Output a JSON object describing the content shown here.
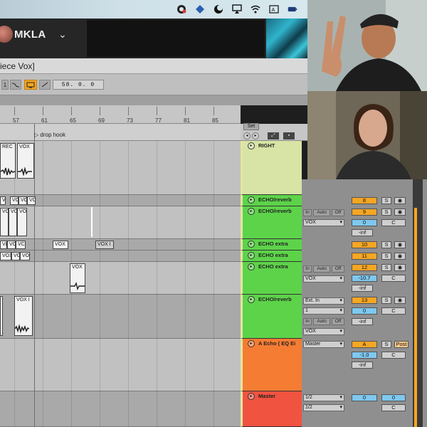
{
  "menubar": {
    "icons": [
      "creative-cloud-icon",
      "app-icon",
      "moon-icon",
      "airplay-icon",
      "wifi-icon",
      "keyboard-icon",
      "battery-icon"
    ]
  },
  "account": {
    "username": "MKLA"
  },
  "ableton": {
    "title": "iece Vox]",
    "transport": {
      "first_button": "1",
      "position": "58.  0.  0"
    },
    "ruler_ticks": [
      "57",
      "61",
      "65",
      "69",
      "73",
      "77",
      "81",
      "85"
    ],
    "locator_label": "drop hook",
    "set_label": "Set"
  },
  "clips": {
    "lane1": [
      "REC",
      "VOX"
    ],
    "lane2": [
      "V",
      "VC",
      "VC",
      "VC"
    ],
    "lane3": [
      "VO",
      "VO",
      "VO"
    ],
    "lane4": [
      "V(",
      "VC",
      "VC"
    ],
    "lane4_extra": [
      "VOX",
      "VOX I"
    ],
    "lane5": [
      "VOX",
      "VO",
      "VO V"
    ],
    "lane6": [
      "VOX"
    ],
    "lane7": [
      "VOX I"
    ]
  },
  "tracks": [
    {
      "name": "RIGHT",
      "color": "#d7e4a5"
    },
    {
      "name": "ECHO/reverb",
      "color": "#5dd34a"
    },
    {
      "name": "ECHO/reverb",
      "color": "#5dd34a"
    },
    {
      "name": "ECHO extra",
      "color": "#5dd34a"
    },
    {
      "name": "ECHO extra",
      "color": "#5dd34a"
    },
    {
      "name": "ECHO extra",
      "color": "#5dd34a"
    },
    {
      "name": "ECHO/reverb",
      "color": "#5dd34a"
    },
    {
      "name": "A Echo ( EQ Ei",
      "color": "#f57c33"
    },
    {
      "name": "Master",
      "color": "#f05340"
    }
  ],
  "mixer": {
    "row_echo1": {
      "num": "8",
      "s": "S"
    },
    "row_echo2": {
      "chips": [
        "In",
        "Auto",
        "Off"
      ],
      "input": "VOX",
      "num": "9",
      "s": "S",
      "vol": "0",
      "pan": "C",
      "send": "-inf"
    },
    "row_extra1": {
      "num": "10",
      "s": "S"
    },
    "row_extra2": {
      "num": "11",
      "s": "S"
    },
    "row_extra3": {
      "chips": [
        "In",
        "Auto",
        "Off"
      ],
      "input": "VOX",
      "num": "12",
      "s": "S",
      "vol": "-10.7",
      "pan": "C",
      "send": "-inf"
    },
    "row_echo3": {
      "input1": "Ext. In",
      "input2": "1",
      "chips": [
        "In",
        "Auto",
        "Off"
      ],
      "input3": "VOX",
      "num": "13",
      "s": "S",
      "vol": "0",
      "pan": "C",
      "send": "-inf"
    },
    "row_aecho": {
      "out": "Master",
      "num": "A",
      "s": "S",
      "post": "Post",
      "vol": "-1.0",
      "pan": "C",
      "send": "-inf"
    },
    "row_master": {
      "out1": "1/2",
      "out2": "1/2",
      "vol": "0",
      "vol2": "0",
      "pan": "C"
    }
  }
}
